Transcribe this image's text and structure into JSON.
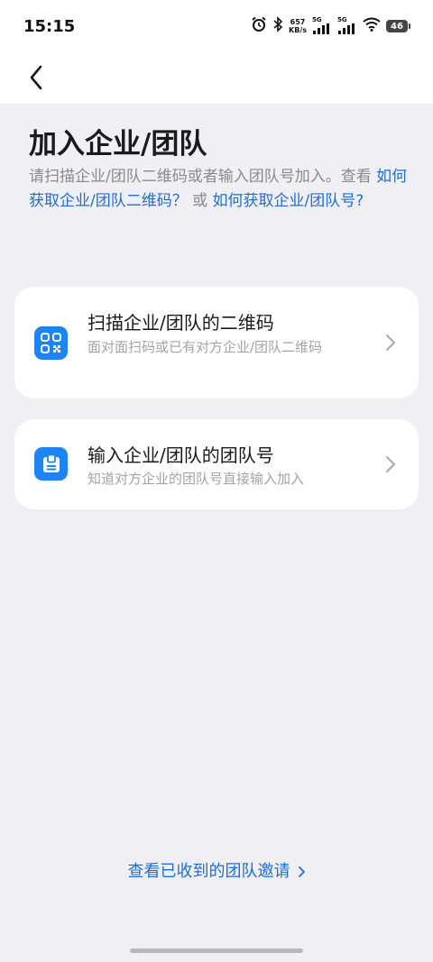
{
  "status": {
    "time": "15:15",
    "speed_value": "657",
    "speed_unit": "KB/s",
    "sim1_label": "5G",
    "sim2_label": "5G",
    "battery": "46",
    "icons": [
      "alarm-icon",
      "bluetooth-icon",
      "wifi-icon",
      "battery-icon"
    ]
  },
  "nav": {
    "back_icon": "chevron-left-icon"
  },
  "page": {
    "title": "加入企业/团队",
    "desc_prefix": "请扫描企业/团队二维码或者输入团队号加入。查看 ",
    "link_qr": "如何获取企业/团队二维码？",
    "desc_or": " 或 ",
    "link_team_no": "如何获取企业/团队号?"
  },
  "cards": [
    {
      "title": "扫描企业/团队的二维码",
      "subtitle": "面对面扫码或已有对方企业/团队二维码",
      "icon": "qr-scan-icon"
    },
    {
      "title": "输入企业/团队的团队号",
      "subtitle": "知道对方企业的团队号直接输入加入",
      "icon": "team-id-icon"
    }
  ],
  "footer": {
    "invite_link": "查看已收到的团队邀请"
  },
  "colors": {
    "accent": "#1e6ed8",
    "icon_bg": "#1d84f3",
    "background": "#f0eff4"
  }
}
